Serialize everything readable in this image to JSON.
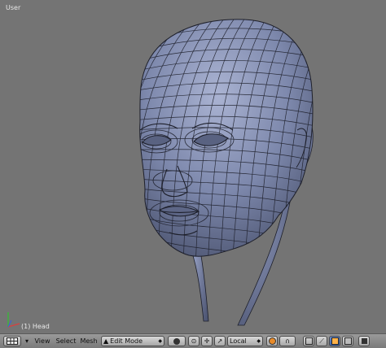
{
  "viewport": {
    "label_view": "User",
    "label_object": "(1) Head",
    "object_icon": "head-wireframe-mesh",
    "background": "#747474",
    "mesh_color": "#6c79a0",
    "wire_color": "#1d1f2a"
  },
  "header": {
    "editor_icon": "viewport-grid-icon",
    "menus": [
      "View",
      "Select",
      "Mesh"
    ],
    "mode": "Edit Mode",
    "orientation": "Local"
  }
}
